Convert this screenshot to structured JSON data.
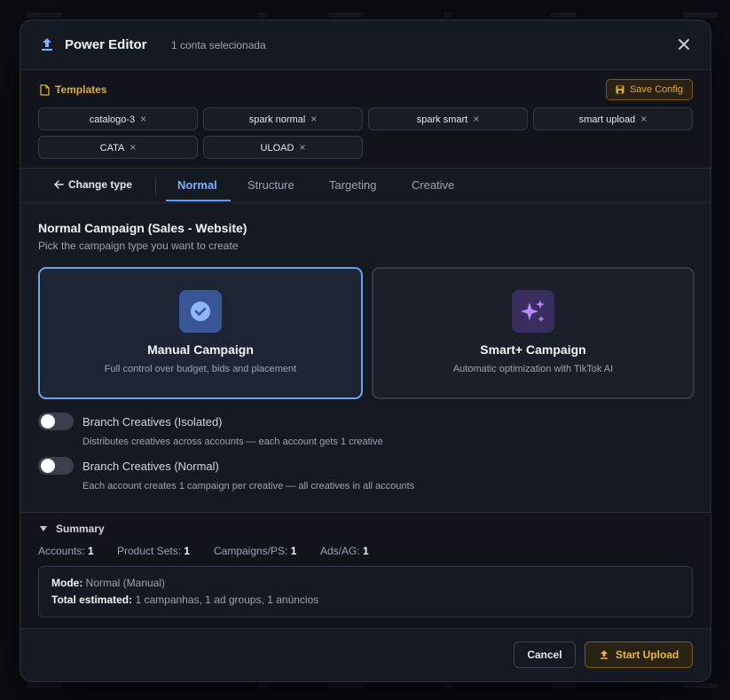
{
  "header": {
    "title": "Power Editor",
    "subtitle": "1 conta selecionada"
  },
  "templates": {
    "label": "Templates",
    "save_label": "Save Config",
    "chips": [
      "catalogo-3",
      "spark normal",
      "spark smart",
      "smart upload",
      "CATA",
      "ULOAD"
    ],
    "remove_glyph": "×"
  },
  "tabs": {
    "change_type": "Change type",
    "items": [
      "Normal",
      "Structure",
      "Targeting",
      "Creative"
    ],
    "active": "Normal"
  },
  "main": {
    "title": "Normal Campaign (Sales - Website)",
    "subtitle": "Pick the campaign type you want to create",
    "cards": [
      {
        "title": "Manual Campaign",
        "desc": "Full control over budget, bids and placement",
        "icon": "check-circle-icon",
        "selected": true
      },
      {
        "title": "Smart+ Campaign",
        "desc": "Automatic optimization with TikTok AI",
        "icon": "sparkles-icon",
        "selected": false
      }
    ],
    "toggles": [
      {
        "label": "Branch Creatives (Isolated)",
        "desc": "Distributes creatives across accounts — each account gets 1 creative",
        "on": false
      },
      {
        "label": "Branch Creatives (Normal)",
        "desc": "Each account creates 1 campaign per creative — all creatives in all accounts",
        "on": false
      }
    ]
  },
  "summary": {
    "title": "Summary",
    "stats": [
      {
        "label": "Accounts:",
        "value": "1"
      },
      {
        "label": "Product Sets:",
        "value": "1"
      },
      {
        "label": "Campaigns/PS:",
        "value": "1"
      },
      {
        "label": "Ads/AG:",
        "value": "1"
      }
    ],
    "mode_label": "Mode:",
    "mode_value": "Normal (Manual)",
    "total_label": "Total estimated:",
    "total_value": "1 campanhas, 1 ad groups, 1 anúncios"
  },
  "footer": {
    "cancel": "Cancel",
    "start": "Start Upload"
  },
  "colors": {
    "accent_blue": "#5b9cff",
    "accent_amber": "#e0a93b",
    "modal_bg": "#151922"
  }
}
